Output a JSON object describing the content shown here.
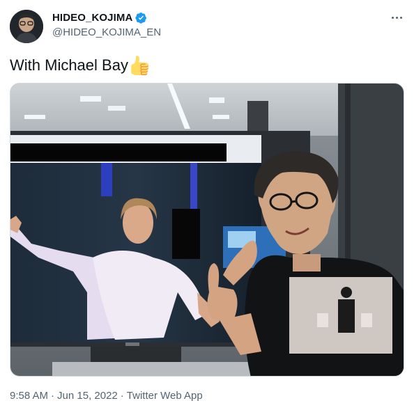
{
  "author": {
    "display_name": "HIDEO_KOJIMA",
    "handle": "@HIDEO_KOJIMA_EN",
    "verified": true,
    "avatar_icon": "avatar-photo"
  },
  "tweet": {
    "text": "With Michael Bay",
    "emoji": "thumbs-up",
    "photo_description_icon": "tweet-photo"
  },
  "meta": {
    "time": "9:58 AM",
    "separator": "·",
    "date": "Jun 15, 2022",
    "source": "Twitter Web App"
  },
  "colors": {
    "accent": "#1d9bf0",
    "text": "#0f1419",
    "secondary": "#536471"
  }
}
